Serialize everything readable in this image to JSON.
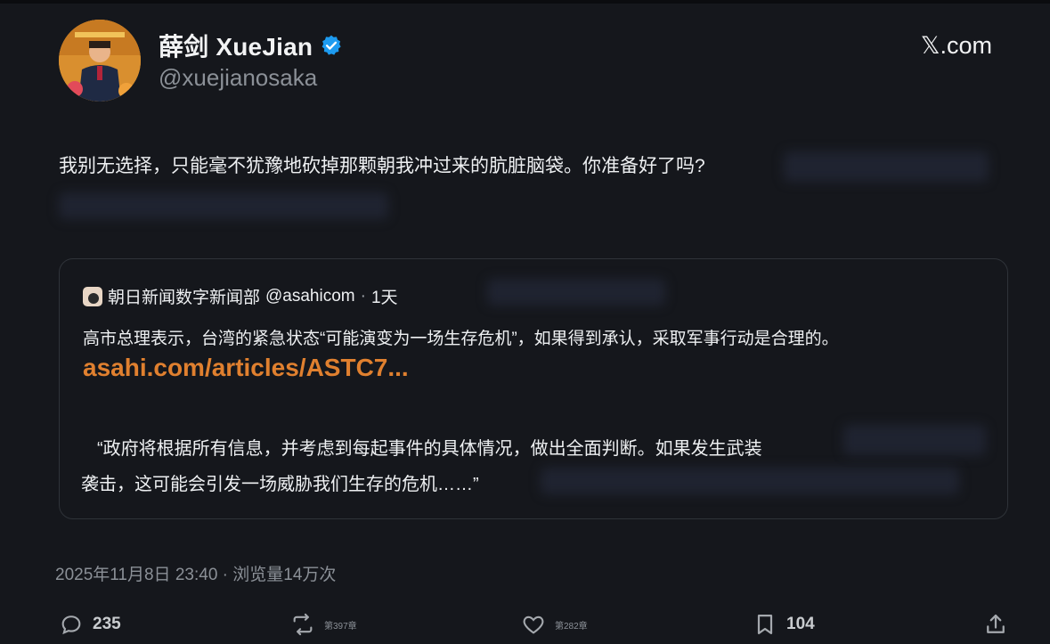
{
  "header": {
    "name": "薛剑 XueJian",
    "handle": "@xuejianosaka",
    "site": "𝕏.com",
    "site_logo": "x-logo-icon",
    "verified": "verified-badge-icon",
    "accent": "#1d9bf0"
  },
  "post": {
    "text": "我别无选择，只能毫不犹豫地砍掉那颗朝我冲过来的肮脏脑袋。你准备好了吗?"
  },
  "quote": {
    "source": "朝日新闻数字新闻部",
    "handle": "@asahicom",
    "dot": "·",
    "time": "1天",
    "body": "高市总理表示，台湾的紧急状态“可能演变为一场生存危机”，如果得到承认，采取军事行动是合理的。",
    "link": "asahi.com/articles/ASTC7...",
    "link_color": "#e0802f",
    "quote_line1": "“政府将根据所有信息，并考虑到每起事件的具体情况，做出全面判断。如果发生武装",
    "quote_line2": "袭击，这可能会引发一场威胁我们生存的危机……”"
  },
  "meta": {
    "datetime": "2025年11月8日 23:40 · 浏览量14万次"
  },
  "actions": {
    "replies": "235",
    "reposts_label": "第397章",
    "likes_label": "第282章",
    "bookmarks": "104"
  }
}
